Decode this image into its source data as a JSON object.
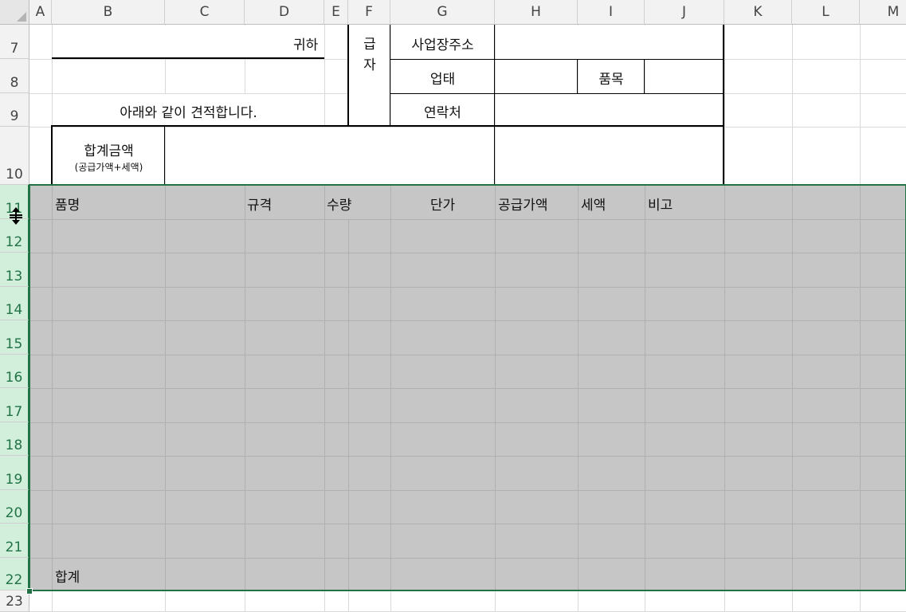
{
  "columns": [
    "A",
    "B",
    "C",
    "D",
    "E",
    "F",
    "G",
    "H",
    "I",
    "J",
    "K",
    "L",
    "M"
  ],
  "rows": [
    "7",
    "8",
    "9",
    "10",
    "11",
    "12",
    "13",
    "14",
    "15",
    "16",
    "17",
    "18",
    "19",
    "20",
    "21",
    "22",
    "23"
  ],
  "form": {
    "recipient_suffix": "귀하",
    "statement": "아래와 같이 견적합니다.",
    "supplier_char1": "급",
    "supplier_char2": "자",
    "address_label": "사업장주소",
    "business_type_label": "업태",
    "item_label": "품목",
    "contact_label": "연락처",
    "total_amount_label": "합계금액",
    "total_amount_sub": "(공급가액+세액)"
  },
  "table": {
    "headers": {
      "item_name": "품명",
      "spec": "규격",
      "quantity": "수량",
      "unit_price": "단가",
      "supply_amount": "공급가액",
      "tax": "세액",
      "note": "비고"
    },
    "total_label": "합계"
  },
  "colors": {
    "selection_accent": "#217346",
    "selection_fill": "#c6c6c6"
  },
  "cursor_icon": "row-resize-cursor-icon"
}
